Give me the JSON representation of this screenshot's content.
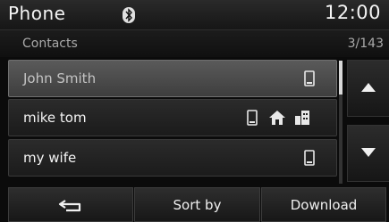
{
  "header": {
    "title": "Phone",
    "time": "12:00",
    "bluetooth_icon": "bluetooth-icon"
  },
  "subheader": {
    "title": "Contacts",
    "count": "3/143"
  },
  "contacts": [
    {
      "name": "John Smith",
      "icons": [
        "mobile-phone-icon"
      ],
      "selected": true
    },
    {
      "name": "mike tom",
      "icons": [
        "mobile-phone-icon",
        "home-icon",
        "office-icon"
      ],
      "selected": false
    },
    {
      "name": "my wife",
      "icons": [
        "mobile-phone-icon"
      ],
      "selected": false
    }
  ],
  "bottom": {
    "back_icon": "back-arrow-icon",
    "sort_label": "Sort by",
    "download_label": "Download"
  }
}
